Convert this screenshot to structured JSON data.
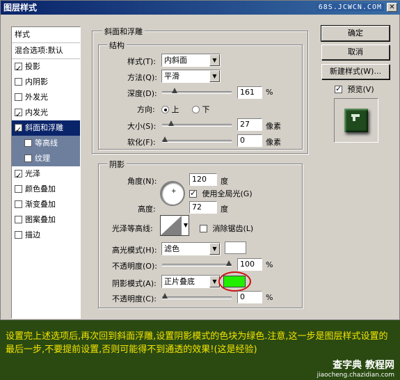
{
  "window": {
    "title": "图层样式",
    "watermark": "68S.JCWCN.COM",
    "close_glyph": "✕"
  },
  "sidebar": {
    "header": "样式",
    "blend_options": "混合选项:默认",
    "items": [
      {
        "label": "投影",
        "checked": true
      },
      {
        "label": "内阴影",
        "checked": false
      },
      {
        "label": "外发光",
        "checked": false
      },
      {
        "label": "内发光",
        "checked": true
      },
      {
        "label": "斜面和浮雕",
        "checked": true,
        "selected": true
      },
      {
        "label": "等高线",
        "checked": false,
        "sub": true
      },
      {
        "label": "纹理",
        "checked": false,
        "sub": true
      },
      {
        "label": "光泽",
        "checked": true
      },
      {
        "label": "颜色叠加",
        "checked": false
      },
      {
        "label": "渐变叠加",
        "checked": false
      },
      {
        "label": "图案叠加",
        "checked": false
      },
      {
        "label": "描边",
        "checked": false
      }
    ]
  },
  "bevel": {
    "group_title": "斜面和浮雕",
    "structure_title": "结构",
    "style_label": "样式(T):",
    "style_value": "内斜面",
    "technique_label": "方法(Q):",
    "technique_value": "平滑",
    "depth_label": "深度(D):",
    "depth_value": "161",
    "depth_unit": "%",
    "depth_level": 0.15,
    "direction_label": "方向:",
    "dir_up": "上",
    "dir_down": "下",
    "size_label": "大小(S):",
    "size_value": "27",
    "size_unit": "像素",
    "size_level": 0.1,
    "soften_label": "软化(F):",
    "soften_value": "0",
    "soften_unit": "像素",
    "soften_level": 0
  },
  "shading": {
    "group_title": "阴影",
    "angle_label": "角度(N):",
    "angle_value": "120",
    "angle_unit": "度",
    "global_light_label": "使用全局光(G)",
    "altitude_label": "高度:",
    "altitude_value": "72",
    "altitude_unit": "度",
    "gloss_label": "光泽等高线:",
    "antialias_label": "消除锯齿(L)",
    "highlight_mode_label": "高光模式(H):",
    "highlight_mode_value": "滤色",
    "highlight_opacity_label": "不透明度(O):",
    "highlight_opacity_value": "100",
    "highlight_opacity_unit": "%",
    "highlight_opacity_level": 1.0,
    "shadow_mode_label": "阴影模式(A):",
    "shadow_mode_value": "正片叠底",
    "shadow_opacity_label": "不透明度(C):",
    "shadow_opacity_value": "0",
    "shadow_opacity_unit": "%",
    "shadow_opacity_level": 0,
    "shadow_color": "#22ee00",
    "highlight_color": "#ffffff",
    "annotation_color": "#cc1111"
  },
  "buttons": {
    "ok": "确定",
    "cancel": "取消",
    "new_style": "新建样式(W)...",
    "preview": "预览(V)"
  },
  "caption": {
    "text": "设置完上述选项后,再次回到斜面浮雕,设置阴影模式的色块为绿色.注意,这一步是图层样式设置的最后一步,不要提前设置,否则可能得不到通透的效果!(这是经验)",
    "logo_main": "查字典 教程网",
    "logo_sub": "jiaocheng.chazidian.com"
  }
}
